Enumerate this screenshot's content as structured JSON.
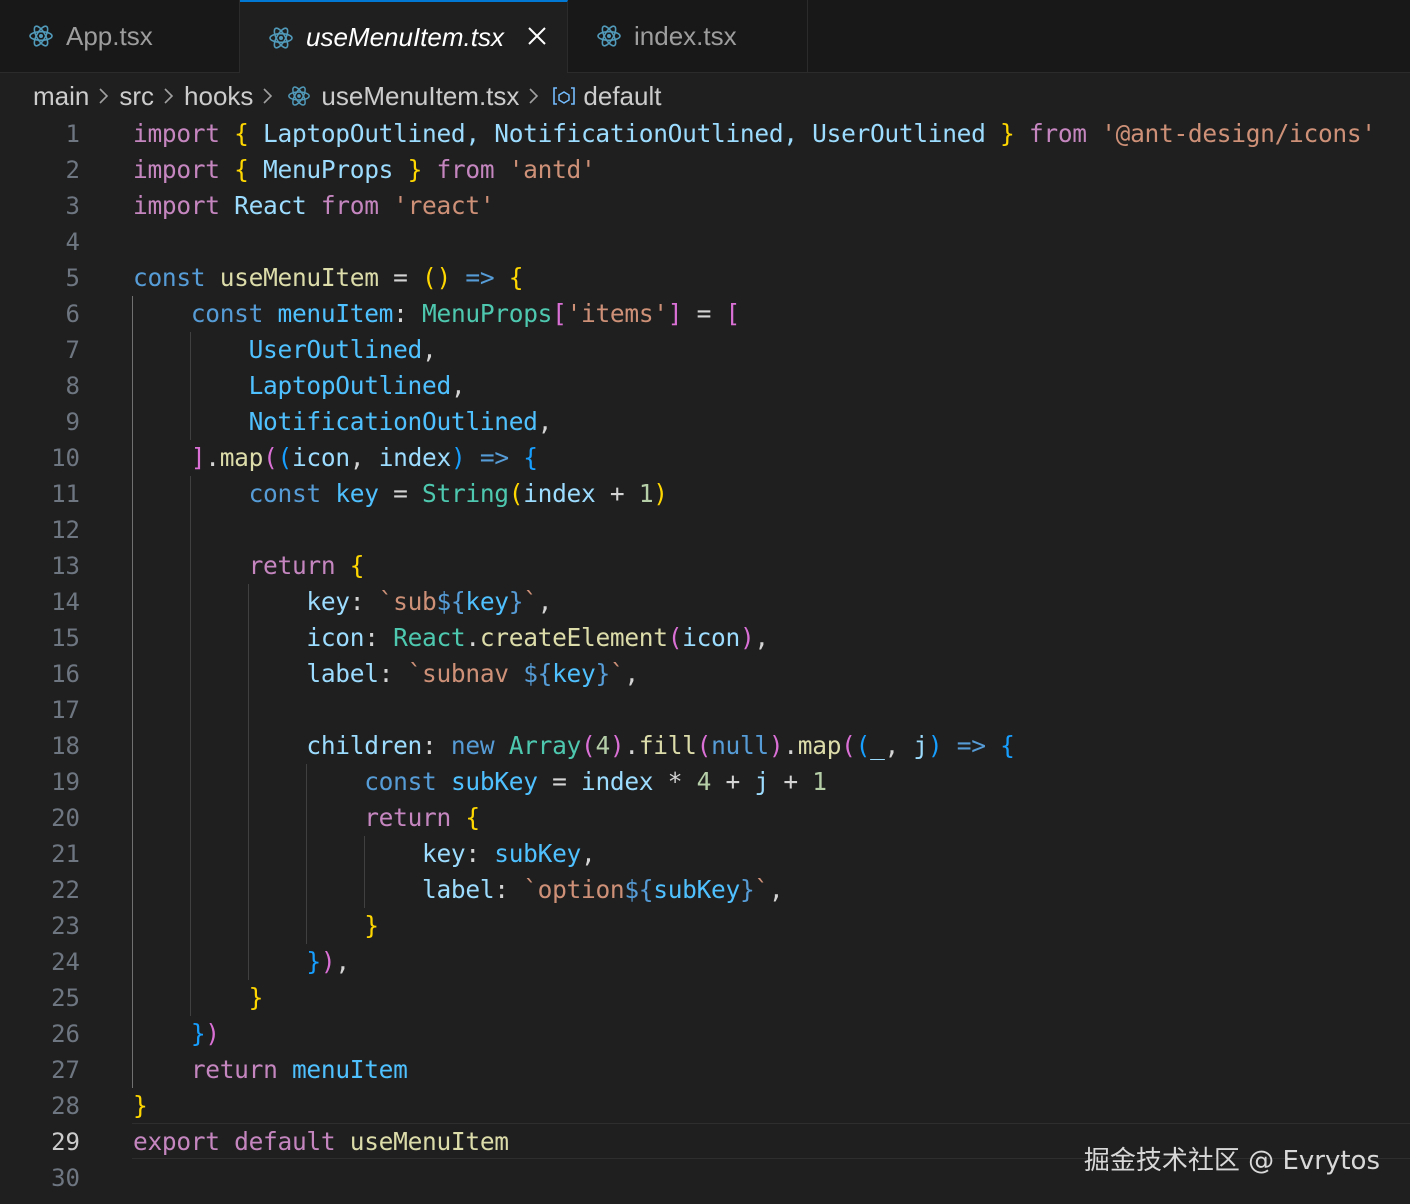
{
  "tabs": [
    {
      "label": "App.tsx",
      "icon": "react-icon"
    },
    {
      "label": "useMenuItem.tsx",
      "icon": "react-icon",
      "active": true
    },
    {
      "label": "index.tsx",
      "icon": "react-icon"
    }
  ],
  "breadcrumb": {
    "items": [
      "main",
      "src",
      "hooks",
      "useMenuItem.tsx",
      "default"
    ]
  },
  "editor": {
    "current_line": 29,
    "lines": [
      {
        "n": "1",
        "tokens": [
          [
            "import",
            "kw"
          ],
          [
            " ",
            "op"
          ],
          [
            "{",
            "p1"
          ],
          [
            " LaptopOutlined, NotificationOutlined, UserOutlined ",
            "id"
          ],
          [
            "}",
            "p1"
          ],
          [
            " ",
            "op"
          ],
          [
            "from",
            "kw"
          ],
          [
            " ",
            "op"
          ],
          [
            "'@ant-design/icons'",
            "str"
          ]
        ]
      },
      {
        "n": "2",
        "tokens": [
          [
            "import",
            "kw"
          ],
          [
            " ",
            "op"
          ],
          [
            "{",
            "p1"
          ],
          [
            " MenuProps ",
            "id"
          ],
          [
            "}",
            "p1"
          ],
          [
            " ",
            "op"
          ],
          [
            "from",
            "kw"
          ],
          [
            " ",
            "op"
          ],
          [
            "'antd'",
            "str"
          ]
        ]
      },
      {
        "n": "3",
        "tokens": [
          [
            "import",
            "kw"
          ],
          [
            " React ",
            "id"
          ],
          [
            "from",
            "kw"
          ],
          [
            " ",
            "op"
          ],
          [
            "'react'",
            "str"
          ]
        ]
      },
      {
        "n": "4",
        "tokens": []
      },
      {
        "n": "5",
        "tokens": [
          [
            "const",
            "st"
          ],
          [
            " ",
            "op"
          ],
          [
            "useMenuItem",
            "fn"
          ],
          [
            " = ",
            "op"
          ],
          [
            "()",
            "p1"
          ],
          [
            " ",
            "op"
          ],
          [
            "=>",
            "st"
          ],
          [
            " ",
            "op"
          ],
          [
            "{",
            "p1"
          ]
        ]
      },
      {
        "n": "6",
        "tokens": [
          [
            "    ",
            "op"
          ],
          [
            "const",
            "st"
          ],
          [
            " ",
            "op"
          ],
          [
            "menuItem",
            "cn"
          ],
          [
            ": ",
            "op"
          ],
          [
            "MenuProps",
            "ty"
          ],
          [
            "[",
            "p2"
          ],
          [
            "'items'",
            "str"
          ],
          [
            "]",
            "p2"
          ],
          [
            " = ",
            "op"
          ],
          [
            "[",
            "p2"
          ]
        ]
      },
      {
        "n": "7",
        "tokens": [
          [
            "        ",
            "op"
          ],
          [
            "UserOutlined",
            "cn"
          ],
          [
            ",",
            "op"
          ]
        ]
      },
      {
        "n": "8",
        "tokens": [
          [
            "        ",
            "op"
          ],
          [
            "LaptopOutlined",
            "cn"
          ],
          [
            ",",
            "op"
          ]
        ]
      },
      {
        "n": "9",
        "tokens": [
          [
            "        ",
            "op"
          ],
          [
            "NotificationOutlined",
            "cn"
          ],
          [
            ",",
            "op"
          ]
        ]
      },
      {
        "n": "10",
        "tokens": [
          [
            "    ",
            "op"
          ],
          [
            "]",
            "p2"
          ],
          [
            ".",
            "op"
          ],
          [
            "map",
            "fn"
          ],
          [
            "(",
            "p2"
          ],
          [
            "(",
            "p3"
          ],
          [
            "icon",
            "id"
          ],
          [
            ", ",
            "op"
          ],
          [
            "index",
            "id"
          ],
          [
            ")",
            "p3"
          ],
          [
            " ",
            "op"
          ],
          [
            "=>",
            "st"
          ],
          [
            " ",
            "op"
          ],
          [
            "{",
            "p3"
          ]
        ]
      },
      {
        "n": "11",
        "tokens": [
          [
            "        ",
            "op"
          ],
          [
            "const",
            "st"
          ],
          [
            " ",
            "op"
          ],
          [
            "key",
            "cn"
          ],
          [
            " = ",
            "op"
          ],
          [
            "String",
            "ty"
          ],
          [
            "(",
            "p1"
          ],
          [
            "index",
            "id"
          ],
          [
            " + ",
            "op"
          ],
          [
            "1",
            "nm"
          ],
          [
            ")",
            "p1"
          ]
        ]
      },
      {
        "n": "12",
        "tokens": []
      },
      {
        "n": "13",
        "tokens": [
          [
            "        ",
            "op"
          ],
          [
            "return",
            "kw"
          ],
          [
            " ",
            "op"
          ],
          [
            "{",
            "p1"
          ]
        ]
      },
      {
        "n": "14",
        "tokens": [
          [
            "            ",
            "op"
          ],
          [
            "key",
            "id"
          ],
          [
            ": ",
            "op"
          ],
          [
            "`sub",
            "str"
          ],
          [
            "${",
            "st"
          ],
          [
            "key",
            "cn"
          ],
          [
            "}",
            "st"
          ],
          [
            "`",
            "str"
          ],
          [
            ",",
            "op"
          ]
        ]
      },
      {
        "n": "15",
        "tokens": [
          [
            "            ",
            "op"
          ],
          [
            "icon",
            "id"
          ],
          [
            ": ",
            "op"
          ],
          [
            "React",
            "ty"
          ],
          [
            ".",
            "op"
          ],
          [
            "createElement",
            "fn"
          ],
          [
            "(",
            "p2"
          ],
          [
            "icon",
            "id"
          ],
          [
            ")",
            "p2"
          ],
          [
            ",",
            "op"
          ]
        ]
      },
      {
        "n": "16",
        "tokens": [
          [
            "            ",
            "op"
          ],
          [
            "label",
            "id"
          ],
          [
            ": ",
            "op"
          ],
          [
            "`subnav ",
            "str"
          ],
          [
            "${",
            "st"
          ],
          [
            "key",
            "cn"
          ],
          [
            "}",
            "st"
          ],
          [
            "`",
            "str"
          ],
          [
            ",",
            "op"
          ]
        ]
      },
      {
        "n": "17",
        "tokens": []
      },
      {
        "n": "18",
        "tokens": [
          [
            "            ",
            "op"
          ],
          [
            "children",
            "id"
          ],
          [
            ": ",
            "op"
          ],
          [
            "new",
            "st"
          ],
          [
            " ",
            "op"
          ],
          [
            "Array",
            "ty"
          ],
          [
            "(",
            "p2"
          ],
          [
            "4",
            "nm"
          ],
          [
            ")",
            "p2"
          ],
          [
            ".",
            "op"
          ],
          [
            "fill",
            "fn"
          ],
          [
            "(",
            "p2"
          ],
          [
            "null",
            "st"
          ],
          [
            ")",
            "p2"
          ],
          [
            ".",
            "op"
          ],
          [
            "map",
            "fn"
          ],
          [
            "(",
            "p2"
          ],
          [
            "(",
            "p3"
          ],
          [
            "_",
            "id"
          ],
          [
            ", ",
            "op"
          ],
          [
            "j",
            "id"
          ],
          [
            ")",
            "p3"
          ],
          [
            " ",
            "op"
          ],
          [
            "=>",
            "st"
          ],
          [
            " ",
            "op"
          ],
          [
            "{",
            "p3"
          ]
        ]
      },
      {
        "n": "19",
        "tokens": [
          [
            "                ",
            "op"
          ],
          [
            "const",
            "st"
          ],
          [
            " ",
            "op"
          ],
          [
            "subKey",
            "cn"
          ],
          [
            " = ",
            "op"
          ],
          [
            "index",
            "id"
          ],
          [
            " * ",
            "op"
          ],
          [
            "4",
            "nm"
          ],
          [
            " + ",
            "op"
          ],
          [
            "j",
            "id"
          ],
          [
            " + ",
            "op"
          ],
          [
            "1",
            "nm"
          ]
        ]
      },
      {
        "n": "20",
        "tokens": [
          [
            "                ",
            "op"
          ],
          [
            "return",
            "kw"
          ],
          [
            " ",
            "op"
          ],
          [
            "{",
            "p1"
          ]
        ]
      },
      {
        "n": "21",
        "tokens": [
          [
            "                    ",
            "op"
          ],
          [
            "key",
            "id"
          ],
          [
            ": ",
            "op"
          ],
          [
            "subKey",
            "cn"
          ],
          [
            ",",
            "op"
          ]
        ]
      },
      {
        "n": "22",
        "tokens": [
          [
            "                    ",
            "op"
          ],
          [
            "label",
            "id"
          ],
          [
            ": ",
            "op"
          ],
          [
            "`option",
            "str"
          ],
          [
            "${",
            "st"
          ],
          [
            "subKey",
            "cn"
          ],
          [
            "}",
            "st"
          ],
          [
            "`",
            "str"
          ],
          [
            ",",
            "op"
          ]
        ]
      },
      {
        "n": "23",
        "tokens": [
          [
            "                ",
            "op"
          ],
          [
            "}",
            "p1"
          ]
        ]
      },
      {
        "n": "24",
        "tokens": [
          [
            "            ",
            "op"
          ],
          [
            "}",
            "p3"
          ],
          [
            ")",
            "p2"
          ],
          [
            ",",
            "op"
          ]
        ]
      },
      {
        "n": "25",
        "tokens": [
          [
            "        ",
            "op"
          ],
          [
            "}",
            "p1"
          ]
        ]
      },
      {
        "n": "26",
        "tokens": [
          [
            "    ",
            "op"
          ],
          [
            "}",
            "p3"
          ],
          [
            ")",
            "p2"
          ]
        ]
      },
      {
        "n": "27",
        "tokens": [
          [
            "    ",
            "op"
          ],
          [
            "return",
            "kw"
          ],
          [
            " ",
            "op"
          ],
          [
            "menuItem",
            "cn"
          ]
        ]
      },
      {
        "n": "28",
        "tokens": [
          [
            "}",
            "p1"
          ]
        ]
      },
      {
        "n": "29",
        "tokens": [
          [
            "export",
            "kw"
          ],
          [
            " ",
            "op"
          ],
          [
            "default",
            "kw"
          ],
          [
            " ",
            "op"
          ],
          [
            "useMenuItem",
            "fn"
          ]
        ]
      },
      {
        "n": "30",
        "tokens": []
      }
    ]
  },
  "watermark": "掘金技术社区 @ Evrytos"
}
